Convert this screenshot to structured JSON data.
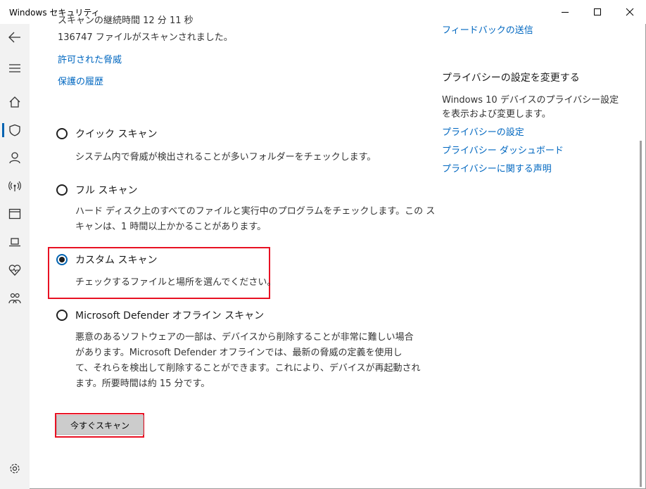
{
  "window": {
    "title": "Windows セキュリティ"
  },
  "partial": {
    "line1": "スキャンの継続時間 12 分 11 秒",
    "line2": "136747 ファイルがスキャンされました。"
  },
  "links": {
    "allowed_threats": "許可された脅威",
    "protection_history": "保護の履歴"
  },
  "options": [
    {
      "label": "クイック スキャン",
      "description": [
        "システム内で脅威が検出されることが多いフォルダーをチェックします。"
      ],
      "selected": false
    },
    {
      "label": "フル スキャン",
      "description": [
        "ハード ディスク上のすべてのファイルと実行中のプログラムをチェックします。この ス",
        "キャンは、1 時間以上かかることがあります。"
      ],
      "selected": false
    },
    {
      "label": "カスタム スキャン",
      "description": [
        "チェックするファイルと場所を選んでください。"
      ],
      "selected": true
    },
    {
      "label": "Microsoft Defender オフライン スキャン",
      "description": [
        "悪意のあるソフトウェアの一部は、デバイスから削除することが非常に難しい場合",
        "があります。Microsoft Defender オフラインでは、最新の脅威の定義を使用し",
        "て、それらを検出して削除することができます。これにより、デバイスが再起動され",
        "ます。所要時間は約 15 分です。"
      ],
      "selected": false
    }
  ],
  "scan_button": "今すぐスキャン",
  "right": {
    "feedback_link": "フィードバックの送信",
    "privacy_heading": "プライバシーの設定を変更する",
    "privacy_text": [
      "Windows 10 デバイスのプライバシー設定",
      "を表示および変更します。"
    ],
    "privacy_settings_link": "プライバシーの設定",
    "privacy_dashboard_link": "プライバシー ダッシュボード",
    "privacy_statement_link": "プライバシーに関する声明"
  },
  "colors": {
    "accent": "#0063b1",
    "link": "#0067c0",
    "highlight": "#e81123",
    "sidebar": "#f2f2f2"
  },
  "icons": [
    "back-arrow-icon",
    "hamburger-menu-icon",
    "home-icon",
    "shield-icon",
    "person-icon",
    "wireless-icon",
    "app-browser-icon",
    "laptop-icon",
    "heart-icon",
    "family-icon",
    "settings-gear-icon",
    "minimize-icon",
    "maximize-icon",
    "close-icon"
  ]
}
